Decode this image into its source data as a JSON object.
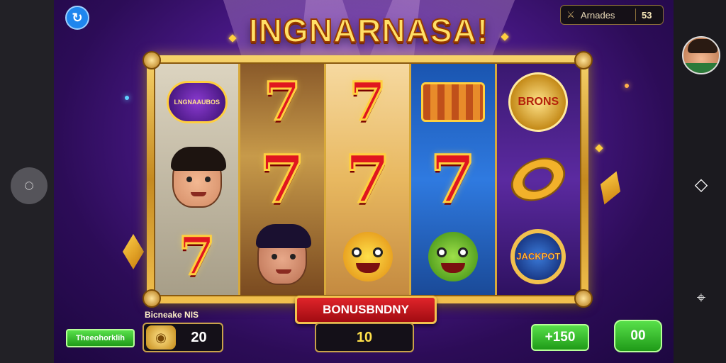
{
  "game": {
    "title": "INGNARNASA!",
    "player_name": "Arnades",
    "player_score": "53",
    "bonus_banner": "BONUSBNDNY",
    "increase_label": "Bicneake NIS",
    "tag_button": "Theeohorklih",
    "bet_value": "20",
    "win_value": "10",
    "plus_button": "+150",
    "spin_button": "00"
  },
  "reels": [
    {
      "symbols": [
        {
          "type": "badge",
          "label": "LNGNAAUBOS",
          "icon": "heart-gem-badge-icon"
        },
        {
          "type": "face",
          "icon": "man-face-icon"
        },
        {
          "type": "seven",
          "label": "7"
        }
      ]
    },
    {
      "symbols": [
        {
          "type": "seven",
          "label": "7"
        },
        {
          "type": "seven",
          "label": "7"
        },
        {
          "type": "face",
          "icon": "cat-eared-man-icon"
        }
      ]
    },
    {
      "symbols": [
        {
          "type": "seven",
          "label": "7"
        },
        {
          "type": "seven",
          "label": "7"
        },
        {
          "type": "creature",
          "icon": "yellow-monster-icon"
        }
      ]
    },
    {
      "symbols": [
        {
          "type": "basket",
          "icon": "fruit-basket-icon"
        },
        {
          "type": "seven",
          "label": "7"
        },
        {
          "type": "creature",
          "icon": "green-goblin-icon"
        }
      ]
    },
    {
      "symbols": [
        {
          "type": "coin",
          "label": "BRONS",
          "icon": "bonus-coin-icon"
        },
        {
          "type": "ring",
          "icon": "gold-ring-icon"
        },
        {
          "type": "medal",
          "label": "JACKPOT",
          "icon": "jackpot-medal-icon"
        }
      ]
    }
  ],
  "colors": {
    "background_purple": "#4c1a8d",
    "frame_gold": "#f2c14e",
    "seven_red": "#e0161f",
    "button_green": "#3fc732",
    "banner_red": "#c8151c"
  }
}
